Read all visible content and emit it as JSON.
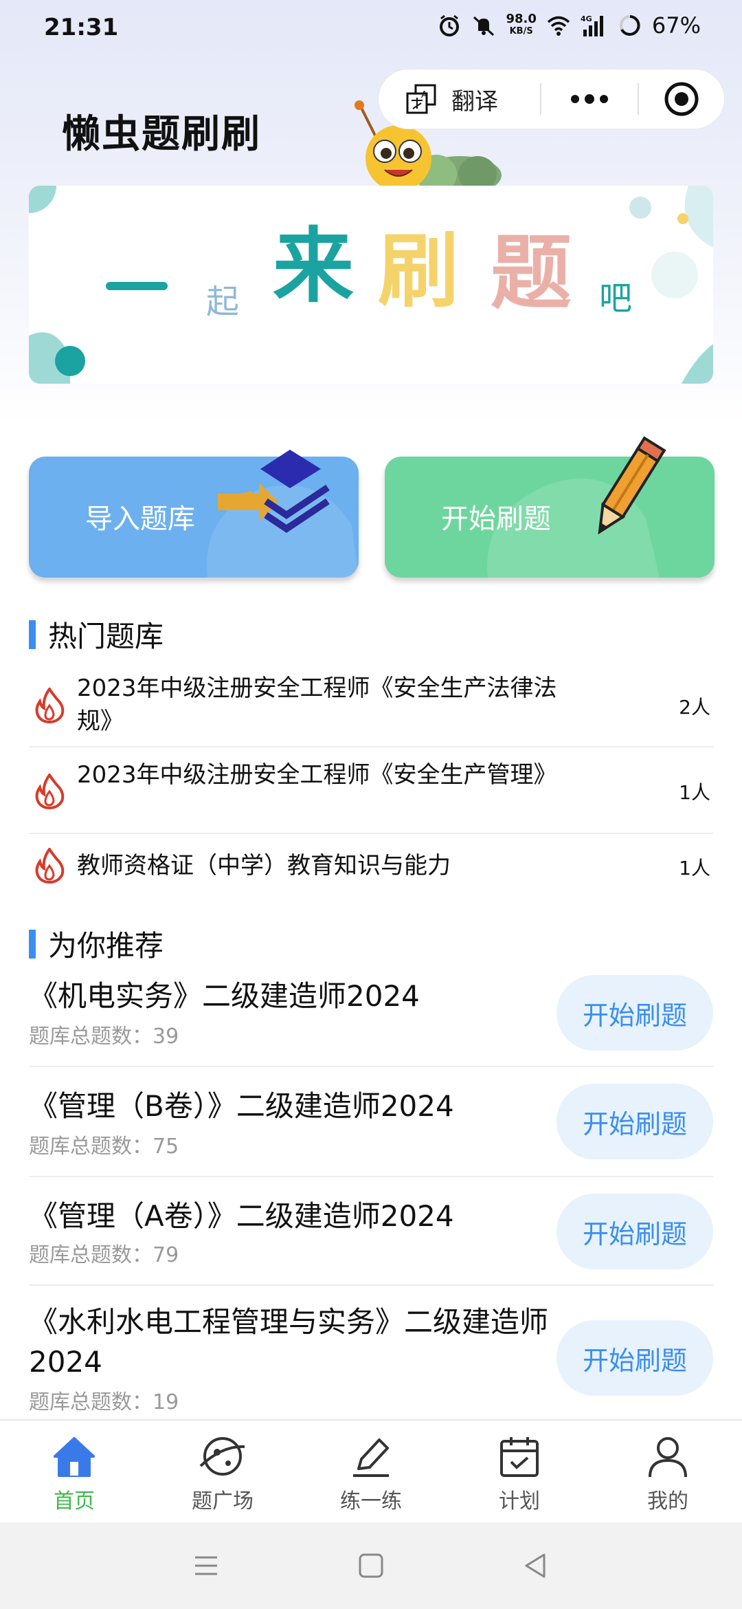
{
  "status_bar": {
    "time": "21:31",
    "net_speed_value": "98.0",
    "net_speed_unit": "KB/S",
    "network": "4G",
    "battery": "67%"
  },
  "header": {
    "title": "懒虫题刷刷",
    "translate_label": "翻译"
  },
  "banner": {
    "chars": [
      "一",
      "起",
      "来",
      "刷",
      "题",
      "吧"
    ]
  },
  "actions": {
    "import_label": "导入题库",
    "start_label": "开始刷题"
  },
  "hot": {
    "title": "热门题库",
    "items": [
      {
        "name": "2023年中级注册安全工程师《安全生产法律法规》",
        "count": "2人"
      },
      {
        "name": "2023年中级注册安全工程师《安全生产管理》",
        "count": "1人"
      },
      {
        "name": "教师资格证（中学）教育知识与能力",
        "count": "1人"
      }
    ]
  },
  "recommend": {
    "title": "为你推荐",
    "items": [
      {
        "name": "《机电实务》二级建造师2024",
        "meta_label": "题库总题数：",
        "total": "39",
        "button": "开始刷题"
      },
      {
        "name": "《管理（B卷）》二级建造师2024",
        "meta_label": "题库总题数：",
        "total": "75",
        "button": "开始刷题"
      },
      {
        "name": "《管理（A卷）》二级建造师2024",
        "meta_label": "题库总题数：",
        "total": "79",
        "button": "开始刷题"
      },
      {
        "name": "《水利水电工程管理与实务》二级建造师2024",
        "meta_label": "题库总题数：",
        "total": "19",
        "button": "开始刷题"
      }
    ]
  },
  "tabbar": {
    "items": [
      {
        "label": "首页",
        "icon": "home-icon",
        "active": true
      },
      {
        "label": "题广场",
        "icon": "planet-icon",
        "active": false
      },
      {
        "label": "练一练",
        "icon": "pen-icon",
        "active": false
      },
      {
        "label": "计划",
        "icon": "calendar-icon",
        "active": false
      },
      {
        "label": "我的",
        "icon": "user-icon",
        "active": false
      }
    ]
  },
  "colors": {
    "accent": "#3a8ef0",
    "active_tab": "#3fb84a",
    "import_card": "#6cb0ef",
    "start_card": "#6dd69e"
  }
}
